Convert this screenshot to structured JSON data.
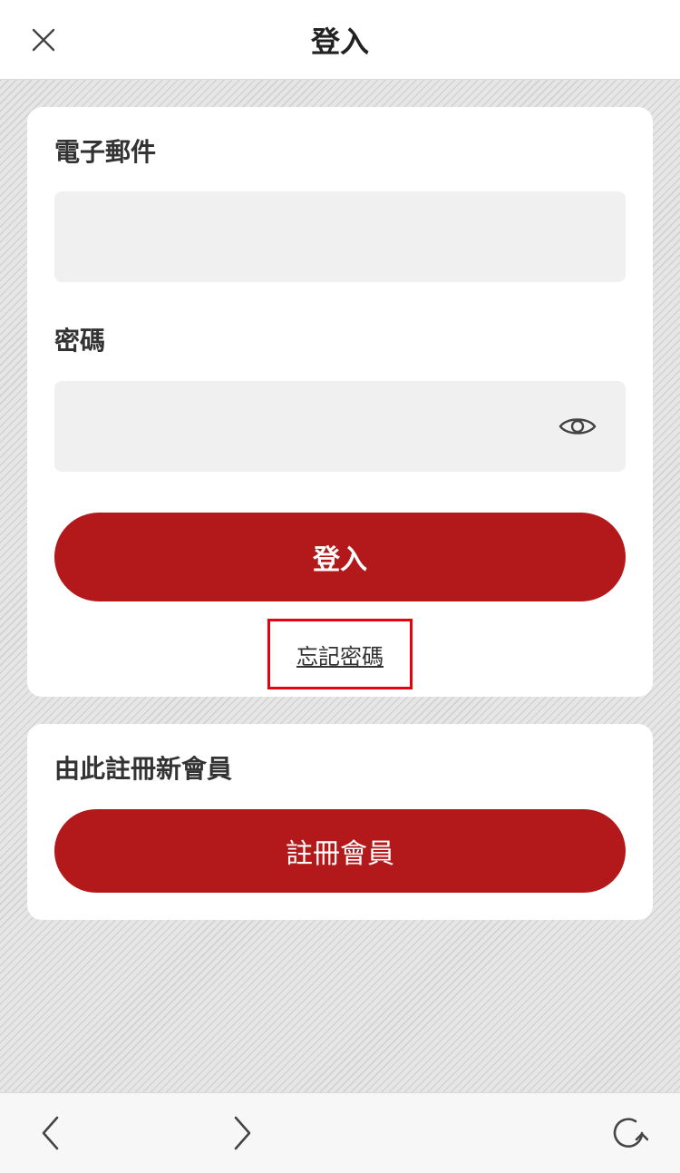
{
  "header": {
    "title": "登入",
    "close_icon": "close-icon"
  },
  "login_form": {
    "email_label": "電子郵件",
    "email_value": "",
    "password_label": "密碼",
    "password_value": "",
    "eye_icon": "eye-icon",
    "login_button_label": "登入",
    "forgot_password_label": "忘記密碼"
  },
  "register": {
    "heading": "由此註冊新會員",
    "button_label": "註冊會員"
  },
  "toolbar": {
    "back_icon": "chevron-left-icon",
    "forward_icon": "chevron-right-icon",
    "reload_icon": "reload-icon"
  },
  "colors": {
    "accent": "#b3191b",
    "highlight_border": "#e8000f",
    "input_background": "#f0f0f0"
  }
}
